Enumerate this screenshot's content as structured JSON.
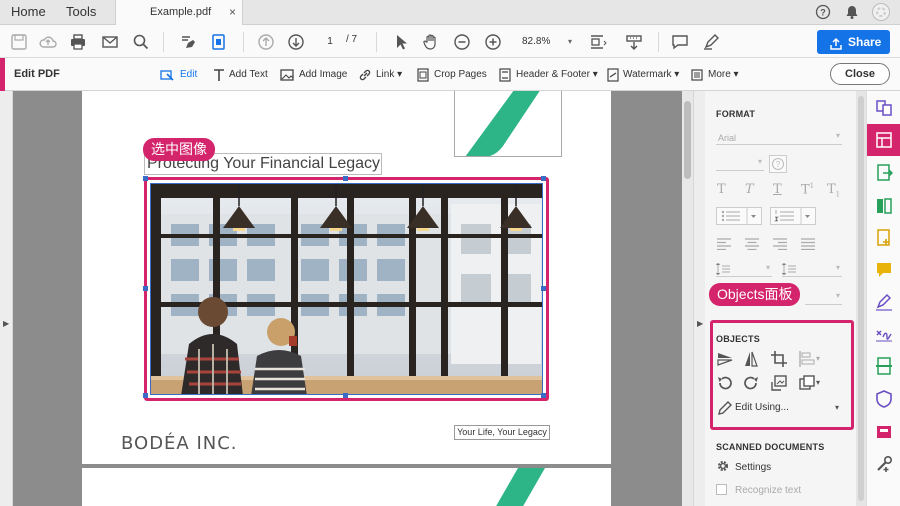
{
  "tabs": {
    "home": "Home",
    "tools": "Tools",
    "document": "Example.pdf",
    "close_glyph": "×"
  },
  "toolbar": {
    "page_current": "1",
    "page_total": "/ 7",
    "zoom": "82.8%",
    "share_label": "Share",
    "accent_color": "#1473e6"
  },
  "editbar": {
    "title": "Edit PDF",
    "tools": [
      {
        "label": "Edit",
        "icon": "edit-cursor-icon"
      },
      {
        "label": "Add Text",
        "icon": "add-text-icon"
      },
      {
        "label": "Add Image",
        "icon": "add-image-icon"
      },
      {
        "label": "Link ▾",
        "icon": "link-icon"
      },
      {
        "label": "Crop Pages",
        "icon": "crop-icon"
      },
      {
        "label": "Header & Footer ▾",
        "icon": "header-footer-icon"
      },
      {
        "label": "Watermark ▾",
        "icon": "watermark-icon"
      },
      {
        "label": "More ▾",
        "icon": "more-icon"
      }
    ],
    "close_label": "Close",
    "accent_color": "#d4246c"
  },
  "document": {
    "headline": "Protecting Your Financial Legacy",
    "company": "BODÉA INC.",
    "tagline": "Your Life, Your Legacy",
    "logo_color": "#2db587"
  },
  "annotations": {
    "select_image": "选中图像",
    "objects_panel": "Objects面板"
  },
  "panel": {
    "format_title": "FORMAT",
    "font_name": "Arial",
    "objects_title": "OBJECTS",
    "edit_using": "Edit Using...",
    "scanned_title": "SCANNED DOCUMENTS",
    "settings": "Settings",
    "recognize": "Recognize text"
  }
}
